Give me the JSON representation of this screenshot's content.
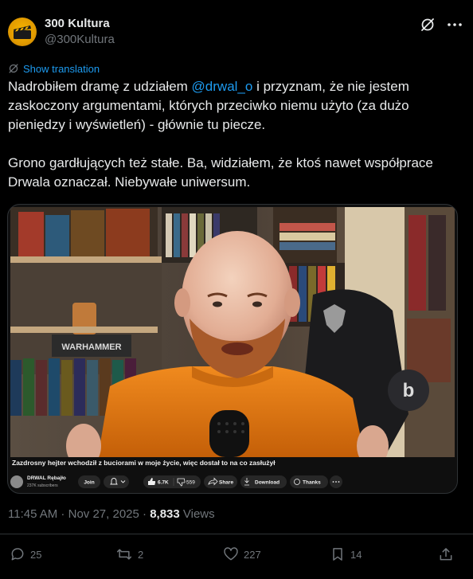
{
  "author": {
    "name": "300 Kultura",
    "handle": "@300Kultura"
  },
  "translate_label": "Show translation",
  "tweet": {
    "para1_before": "Nadrobiłem dramę z udziałem ",
    "mention": "@drwal_o",
    "para1_after": " i przyznam, że nie jestem zaskoczony argumentami, których przeciwko niemu użyto (za dużo pieniędzy i wyświetleń) - głównie tu piecze.",
    "para2": "Grono gardłujących też stałe. Ba, widziałem, że ktoś nawet współprace Drwala oznaczał. Niebywałe uniwersum."
  },
  "video": {
    "title": "Zazdrosny hejter wchodził z buciorami w moje życie, więc dostał to na co zasłużył",
    "channel": "DRWAL Rębajło",
    "subscribers": "237K subscribers",
    "join_label": "Join",
    "likes": "6.7K",
    "dislikes": "559",
    "share_label": "Share",
    "download_label": "Download",
    "thanks_label": "Thanks",
    "shelf_label": "WARHAMMER"
  },
  "meta": {
    "time": "11:45 AM",
    "separator": " · ",
    "date": "Nov 27, 2025",
    "views_count": "8,833",
    "views_label": " Views"
  },
  "actions": {
    "replies": "25",
    "reposts": "2",
    "likes": "227",
    "bookmarks": "14"
  },
  "colors": {
    "accent": "#1d9bf0",
    "muted": "#71767b",
    "background": "#000000"
  }
}
